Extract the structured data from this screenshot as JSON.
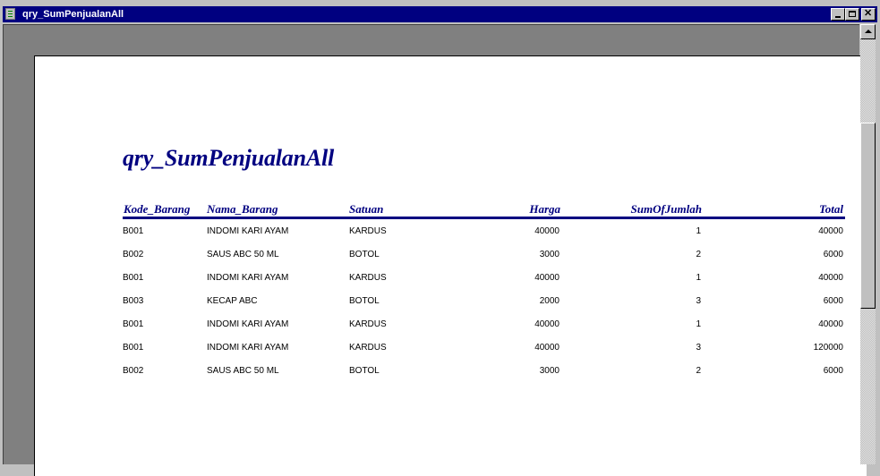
{
  "window": {
    "title": "qry_SumPenjualanAll"
  },
  "report": {
    "title": "qry_SumPenjualanAll",
    "columns": [
      "Kode_Barang",
      "Nama_Barang",
      "Satuan",
      "Harga",
      "SumOfJumlah",
      "Total"
    ],
    "rows": [
      [
        "B001",
        "INDOMI KARI AYAM",
        "KARDUS",
        "40000",
        "1",
        "40000"
      ],
      [
        "B002",
        "SAUS ABC 50 ML",
        "BOTOL",
        "3000",
        "2",
        "6000"
      ],
      [
        "B001",
        "INDOMI KARI AYAM",
        "KARDUS",
        "40000",
        "1",
        "40000"
      ],
      [
        "B003",
        "KECAP ABC",
        "BOTOL",
        "2000",
        "3",
        "6000"
      ],
      [
        "B001",
        "INDOMI KARI AYAM",
        "KARDUS",
        "40000",
        "1",
        "40000"
      ],
      [
        "B001",
        "INDOMI KARI AYAM",
        "KARDUS",
        "40000",
        "3",
        "120000"
      ],
      [
        "B002",
        "SAUS ABC 50 ML",
        "BOTOL",
        "3000",
        "2",
        "6000"
      ]
    ]
  },
  "colors": {
    "title_bar": "#000080",
    "heading": "#000080",
    "workspace": "#808080",
    "paper": "#ffffff"
  }
}
